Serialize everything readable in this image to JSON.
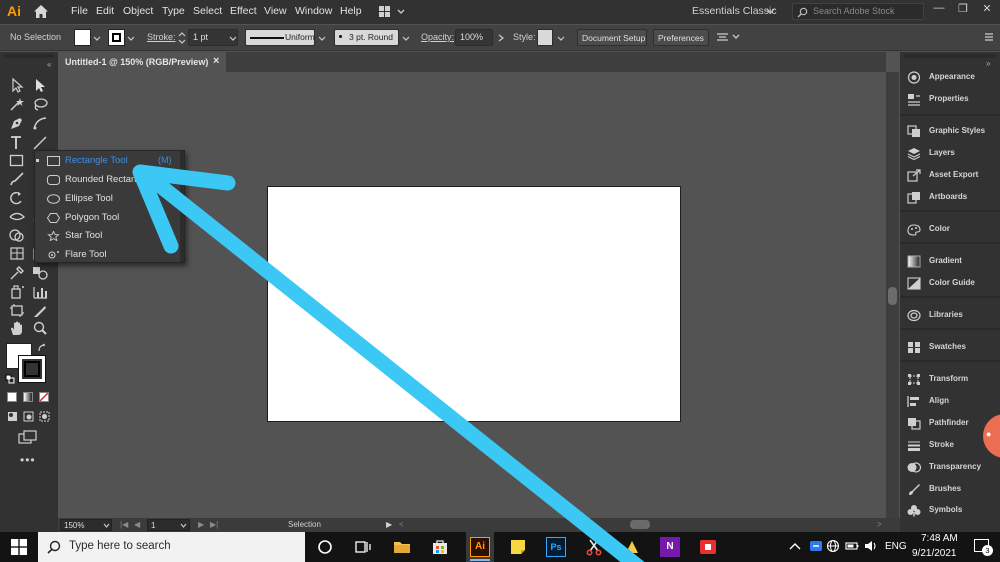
{
  "app": {
    "logo": "Ai",
    "menu": [
      "File",
      "Edit",
      "Object",
      "Type",
      "Select",
      "Effect",
      "View",
      "Window",
      "Help"
    ],
    "workspace": "Essentials Classic",
    "search_placeholder": "Search Adobe Stock"
  },
  "control_bar": {
    "selection_label": "No Selection",
    "stroke_label": "Stroke:",
    "stroke_weight": "1 pt",
    "profile": "Uniform",
    "brush": "3 pt. Round",
    "opacity_label": "Opacity:",
    "opacity_value": "100%",
    "style_label": "Style:",
    "document_setup": "Document Setup",
    "preferences": "Preferences"
  },
  "document": {
    "tab_title": "Untitled-1 @ 150% (RGB/Preview)",
    "close": "×"
  },
  "flyout": {
    "items": [
      {
        "label": "Rectangle Tool",
        "shortcut": "(M)",
        "icon": "rectangle-icon",
        "active": true
      },
      {
        "label": "Rounded Rectangle Tool",
        "icon": "rounded-rectangle-icon"
      },
      {
        "label": "Ellipse Tool",
        "icon": "ellipse-icon"
      },
      {
        "label": "Polygon Tool",
        "icon": "polygon-icon"
      },
      {
        "label": "Star Tool",
        "icon": "star-icon"
      },
      {
        "label": "Flare Tool",
        "icon": "flare-icon"
      }
    ]
  },
  "panels": [
    {
      "label": "Appearance",
      "icon": "appearance-icon"
    },
    {
      "label": "Properties",
      "icon": "properties-icon"
    },
    {
      "label": "Graphic Styles",
      "icon": "graphic-styles-icon"
    },
    {
      "label": "Layers",
      "icon": "layers-icon"
    },
    {
      "label": "Asset Export",
      "icon": "asset-export-icon"
    },
    {
      "label": "Artboards",
      "icon": "artboards-icon"
    },
    {
      "label": "Color",
      "icon": "color-icon"
    },
    {
      "label": "Gradient",
      "icon": "gradient-icon"
    },
    {
      "label": "Color Guide",
      "icon": "color-guide-icon"
    },
    {
      "label": "Libraries",
      "icon": "libraries-icon"
    },
    {
      "label": "Swatches",
      "icon": "swatches-icon"
    },
    {
      "label": "Transform",
      "icon": "transform-icon"
    },
    {
      "label": "Align",
      "icon": "align-icon"
    },
    {
      "label": "Pathfinder",
      "icon": "pathfinder-icon"
    },
    {
      "label": "Stroke",
      "icon": "stroke-icon"
    },
    {
      "label": "Transparency",
      "icon": "transparency-icon"
    },
    {
      "label": "Brushes",
      "icon": "brushes-icon"
    },
    {
      "label": "Symbols",
      "icon": "symbols-icon"
    }
  ],
  "status_bar": {
    "zoom": "150%",
    "artboard_number": "1",
    "tool_status": "Selection"
  },
  "taskbar": {
    "search_placeholder": "Type here to search",
    "language": "ENG",
    "time": "7:48 AM",
    "date": "9/21/2021",
    "notification_count": "3"
  },
  "colors": {
    "accent_blue": "#3b8ee8",
    "annotation_arrow": "#3cc8f4",
    "illustrator_orange": "#ff9a00"
  }
}
